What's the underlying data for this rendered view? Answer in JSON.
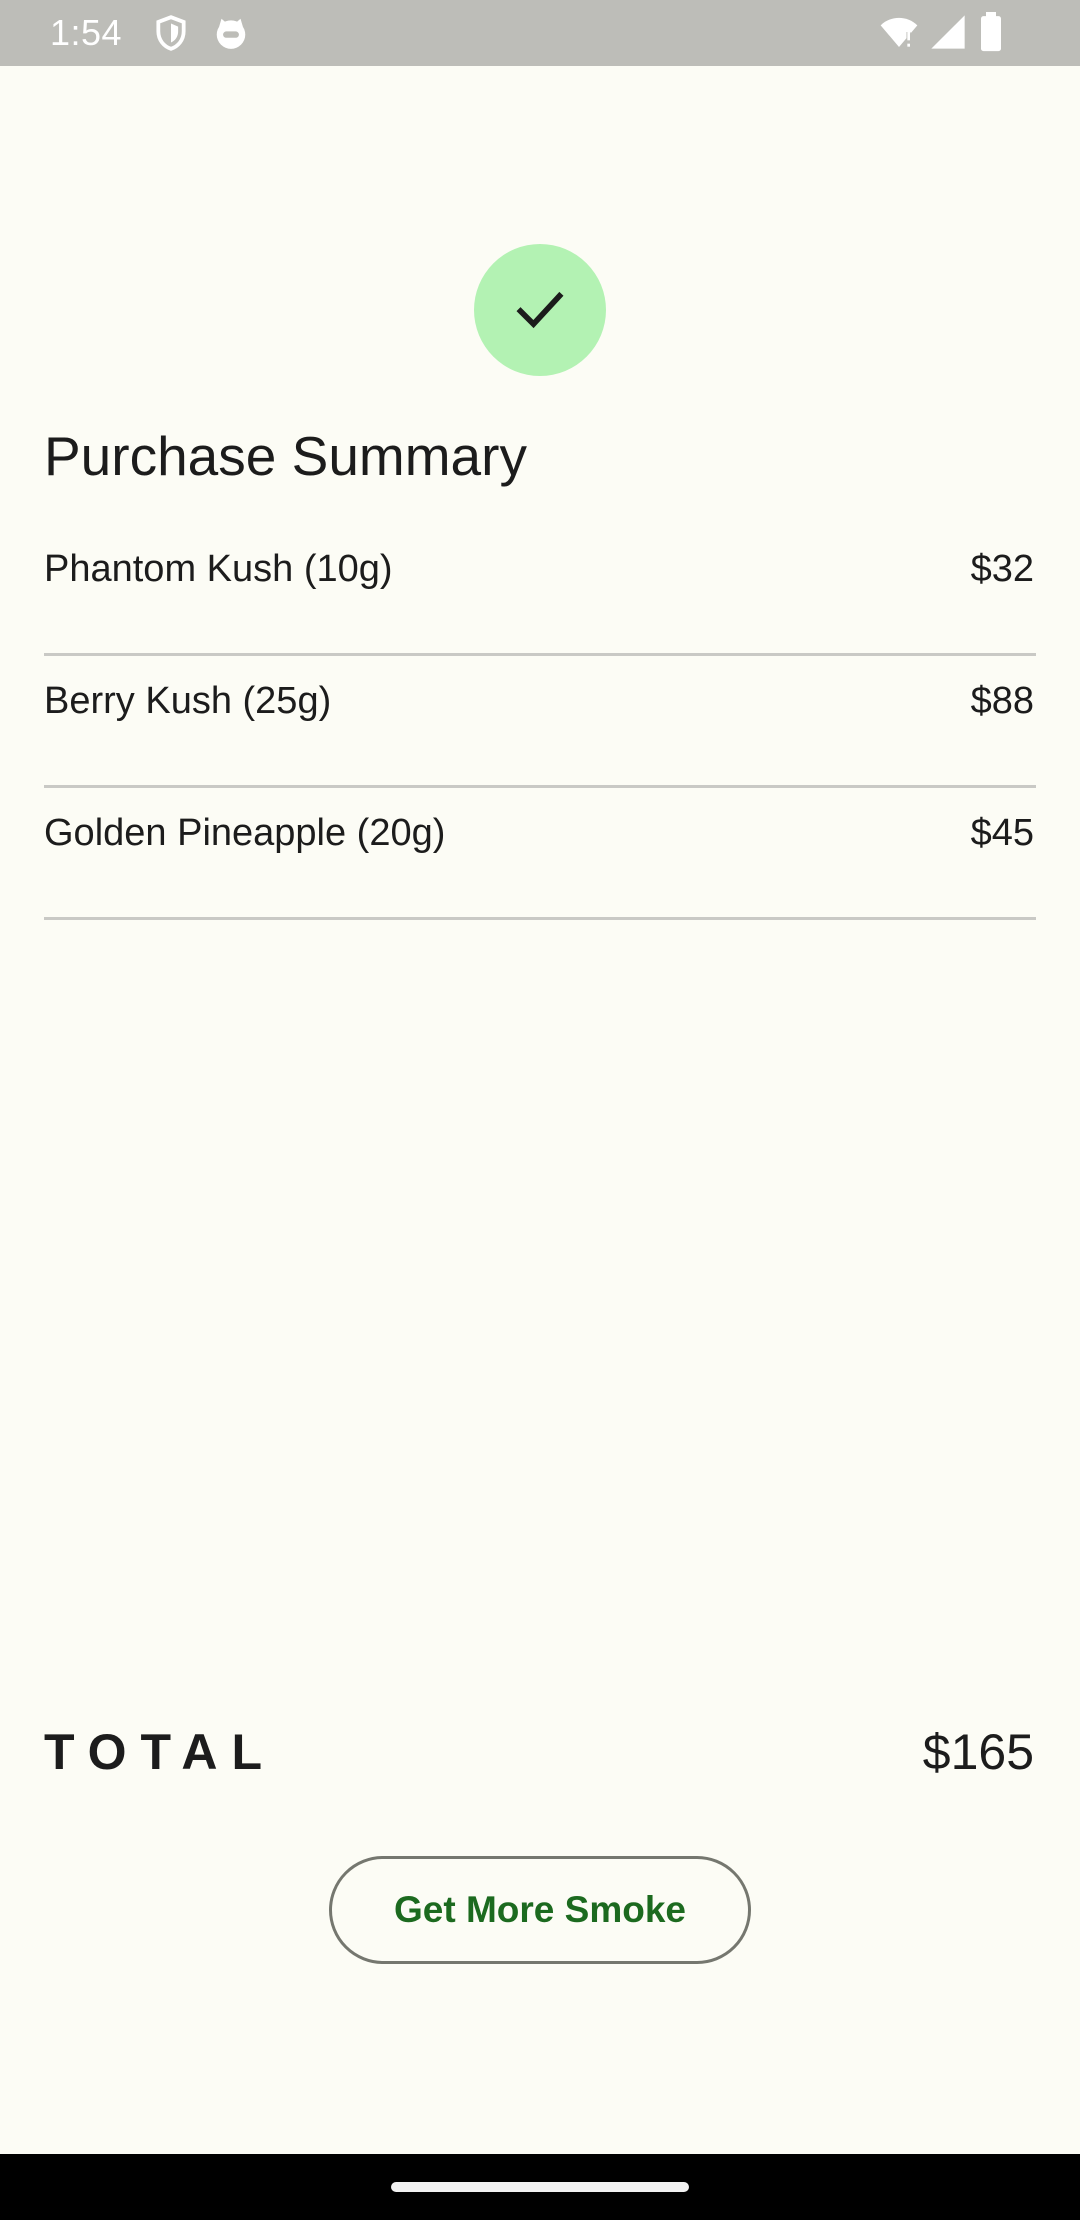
{
  "status_bar": {
    "time": "1:54",
    "icons": [
      "shield-icon",
      "cat-face-icon",
      "wifi-icon",
      "cellular-signal-icon",
      "battery-icon"
    ]
  },
  "success_icon": "check-icon",
  "title": "Purchase Summary",
  "items": [
    {
      "name": "Phantom Kush (10g)",
      "price": "$32"
    },
    {
      "name": "Berry Kush (25g)",
      "price": "$88"
    },
    {
      "name": "Golden Pineapple (20g)",
      "price": "$45"
    }
  ],
  "total": {
    "label": "TOTAL",
    "value": "$165"
  },
  "cta": {
    "label": "Get More Smoke"
  },
  "colors": {
    "background": "#FCFCF5",
    "status_bar": "#BDBDB8",
    "success_circle": "#B3F2B3",
    "accent_text": "#1C6A1F",
    "divider": "#C9C9C5"
  }
}
